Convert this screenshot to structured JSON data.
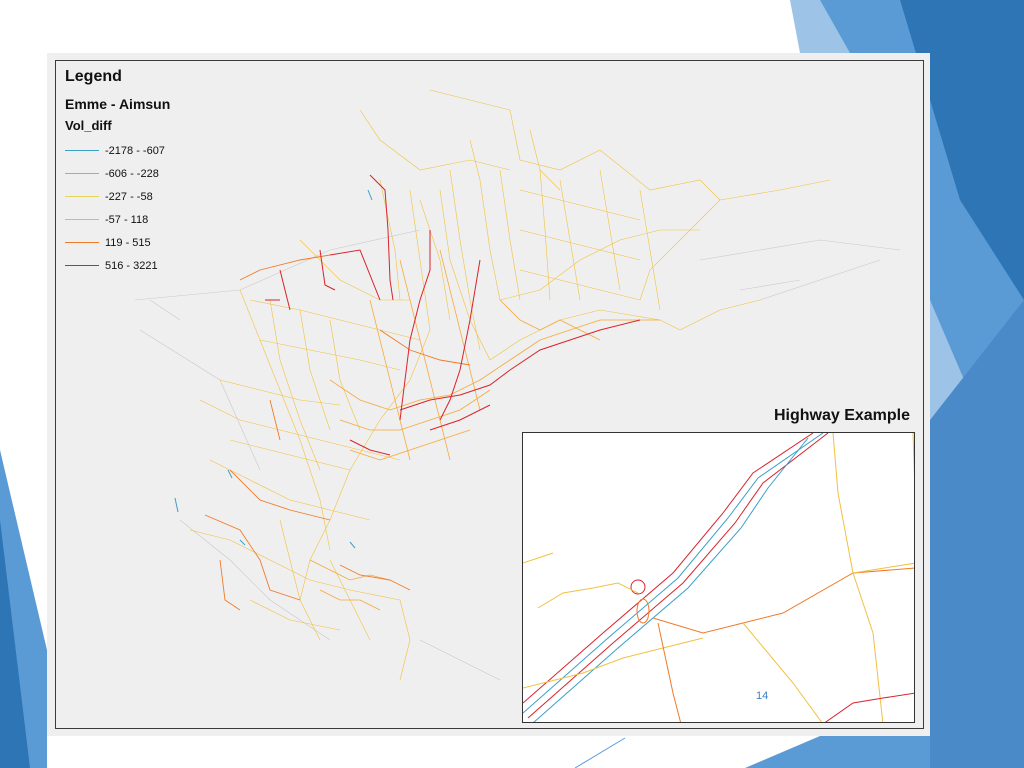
{
  "legend": {
    "title": "Legend",
    "subtitle": "Emme - Aimsun",
    "field": "Vol_diff",
    "classes": [
      {
        "label": "-2178 - -607",
        "color": "#3aa0c8"
      },
      {
        "label": "-606 - -228",
        "color": "#8fb1c2"
      },
      {
        "label": "-227 - -58",
        "color": "#e6d35a"
      },
      {
        "label": "-57 - 118",
        "color": "#f2b43c"
      },
      {
        "label": "119 - 515",
        "color": "#f07a2a"
      },
      {
        "label": "516 - 3221",
        "color": "#d9232c"
      }
    ]
  },
  "inset": {
    "title": "Highway Example",
    "label": "14"
  },
  "colors": {
    "slide_accent": "#5b9bd5",
    "map_background": "#efefef"
  }
}
